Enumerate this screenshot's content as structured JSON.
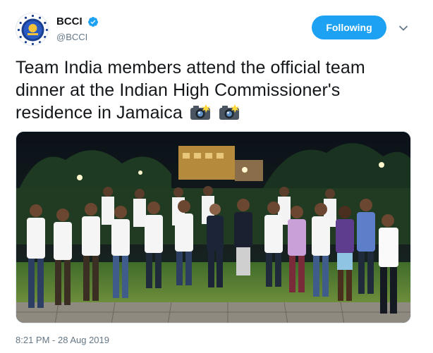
{
  "account": {
    "display_name": "BCCI",
    "handle": "@BCCI",
    "verified": true,
    "avatar_icon": "bcci-logo"
  },
  "actions": {
    "follow_label": "Following",
    "menu_icon": "chevron-down-icon"
  },
  "tweet": {
    "text": "Team India members attend the official team dinner at the Indian High Commissioner's residence in Jamaica",
    "emojis": [
      "camera-flash-icon",
      "camera-flash-icon"
    ]
  },
  "photo": {
    "subject": "team-group-photo"
  },
  "timestamp": "8:21 PM - 28 Aug 2019",
  "colors": {
    "accent": "#1da1f2",
    "text": "#14171a",
    "muted": "#657786"
  }
}
